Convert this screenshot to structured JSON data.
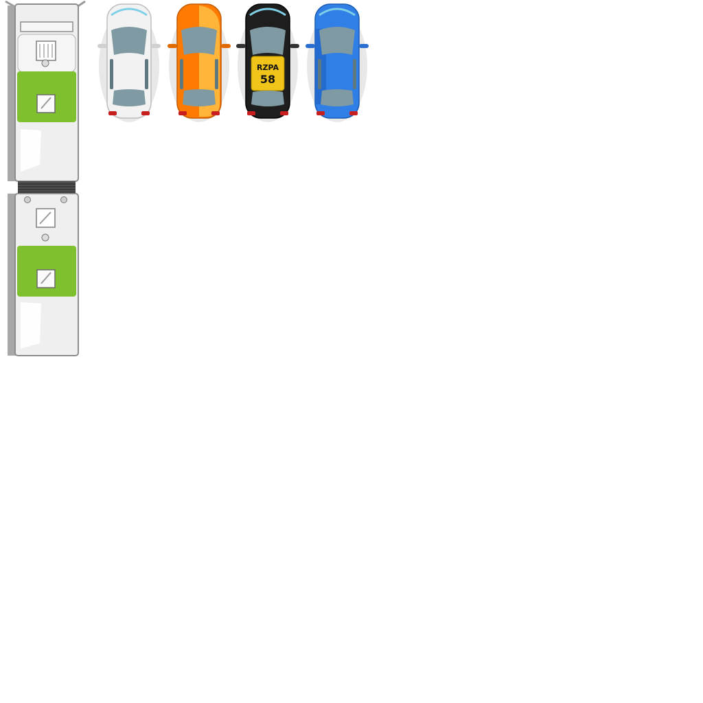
{
  "sprites": {
    "bus": {
      "icon": "articulated-bus-topdown-icon",
      "body_color": "#eeeeee",
      "roof_accent_color": "#7fc02f"
    },
    "cars": [
      {
        "icon": "car-topdown-icon",
        "body_color": "#f2f2f2"
      },
      {
        "icon": "car-topdown-icon",
        "body_color": "#ff7a00",
        "highlight_color": "#ffb43a"
      },
      {
        "icon": "taxi-topdown-icon",
        "body_color": "#1e1e1e",
        "roof_sign_color": "#f0c419",
        "roof_sign_text": {
          "line1": "RZPA",
          "line2": "58"
        }
      },
      {
        "icon": "car-topdown-icon",
        "body_color": "#2f7fe6"
      }
    ]
  }
}
